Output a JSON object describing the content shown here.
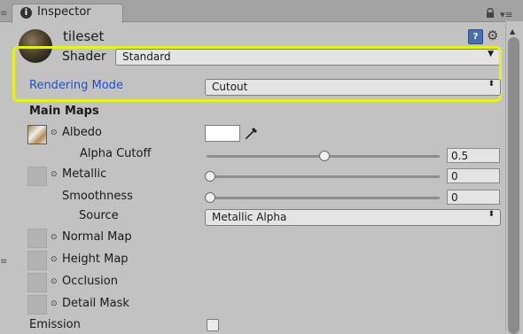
{
  "tab": {
    "label": "Inspector"
  },
  "header": {
    "title": "tileset",
    "shader_label": "Shader",
    "shader_value": "Standard"
  },
  "rendering": {
    "label": "Rendering Mode",
    "value": "Cutout"
  },
  "main_maps": {
    "title": "Main Maps",
    "albedo_label": "Albedo",
    "albedo_color": "#ffffff",
    "alpha_cutoff_label": "Alpha Cutoff",
    "alpha_cutoff_value": "0.5",
    "metallic_label": "Metallic",
    "metallic_value": "0",
    "smoothness_label": "Smoothness",
    "smoothness_value": "0",
    "source_label": "Source",
    "source_value": "Metallic Alpha",
    "normal_map_label": "Normal Map",
    "height_map_label": "Height Map",
    "occlusion_label": "Occlusion",
    "detail_mask_label": "Detail Mask",
    "emission_label": "Emission"
  },
  "sliders": {
    "alpha_cutoff_fraction": 0.5,
    "metallic_fraction": 0,
    "smoothness_fraction": 0
  },
  "colors": {
    "highlight": "#e5f11c",
    "rendering_label": "#1f4fd0",
    "help_icon": "#4a6fb0"
  }
}
